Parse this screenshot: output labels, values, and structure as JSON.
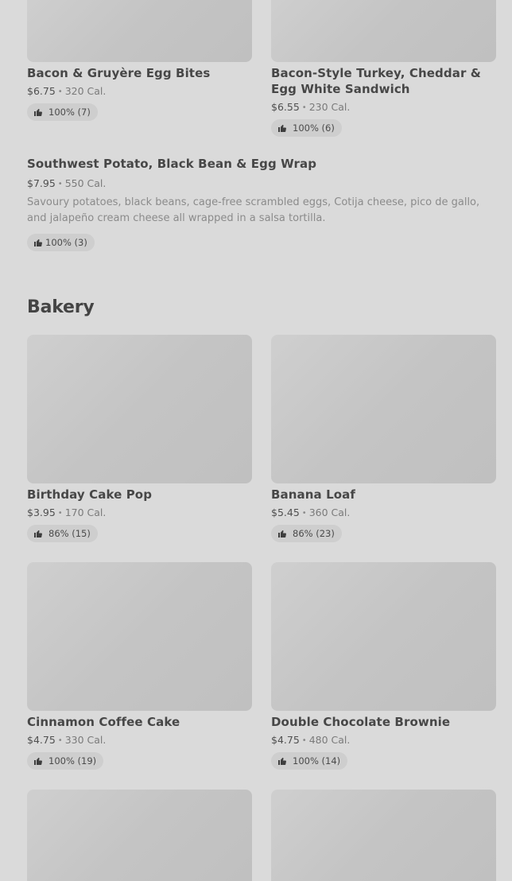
{
  "items": [
    {
      "name": "Bacon & Gruyère Egg Bites",
      "price": "$6.75",
      "cal": "320 Cal.",
      "rating": "100% (7)"
    },
    {
      "name": "Bacon-Style Turkey, Cheddar & Egg White Sandwich",
      "price": "$6.55",
      "cal": "230 Cal.",
      "rating": "100% (6)"
    },
    {
      "name": "Southwest Potato, Black Bean & Egg Wrap",
      "price": "$7.95",
      "cal": "550 Cal.",
      "desc": "Savoury potatoes, black beans, cage-free scrambled eggs, Cotija cheese, pico de gallo, and jalapeño cream cheese all wrapped in a salsa tortilla.",
      "rating": "100% (3)"
    },
    {
      "name": "Birthday Cake Pop",
      "price": "$3.95",
      "cal": "170 Cal.",
      "rating": "86% (15)"
    },
    {
      "name": "Banana Loaf",
      "price": "$5.45",
      "cal": "360 Cal.",
      "rating": "86% (23)"
    },
    {
      "name": "Cinnamon Coffee Cake",
      "price": "$4.75",
      "cal": "330 Cal.",
      "rating": "100% (19)"
    },
    {
      "name": "Double Chocolate Brownie",
      "price": "$4.75",
      "cal": "480 Cal.",
      "rating": "100% (14)"
    }
  ],
  "sections": {
    "bakery": "Bakery"
  },
  "separator": "•",
  "icons": {
    "rating": "thumbs-up-icon"
  }
}
